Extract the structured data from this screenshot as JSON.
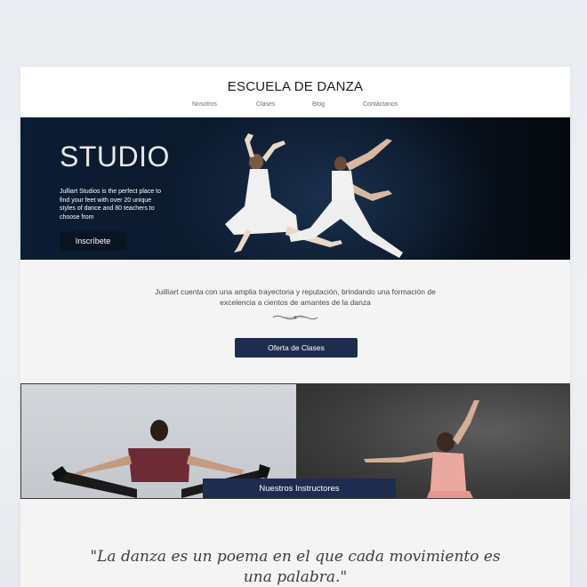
{
  "header": {
    "site_title": "ESCUELA DE DANZA",
    "nav": [
      "Nosotros",
      "Clases",
      "Blog",
      "Contáctanos"
    ]
  },
  "hero": {
    "heading": "STUDIO",
    "description": "Julliart Studios is the perfect place to find your feet with over 20 unique styles of dance and 80 teachers to choose from",
    "button_label": "Inscríbete"
  },
  "about": {
    "text": "Juilliart cuenta con una amplia trayectoria y reputación, brindando una formación de excelencia a cientos de amantes de la danza",
    "button_label": "Oferta de Clases"
  },
  "instructors": {
    "button_label": "Nuestros Instructores"
  },
  "quote": {
    "text": "\"La danza es un poema en el que cada movimiento es una palabra.\""
  },
  "colors": {
    "accent_button": "#1e2d4f",
    "hero_bg": "#0b1c33",
    "page_bg": "#f4f4f4"
  }
}
